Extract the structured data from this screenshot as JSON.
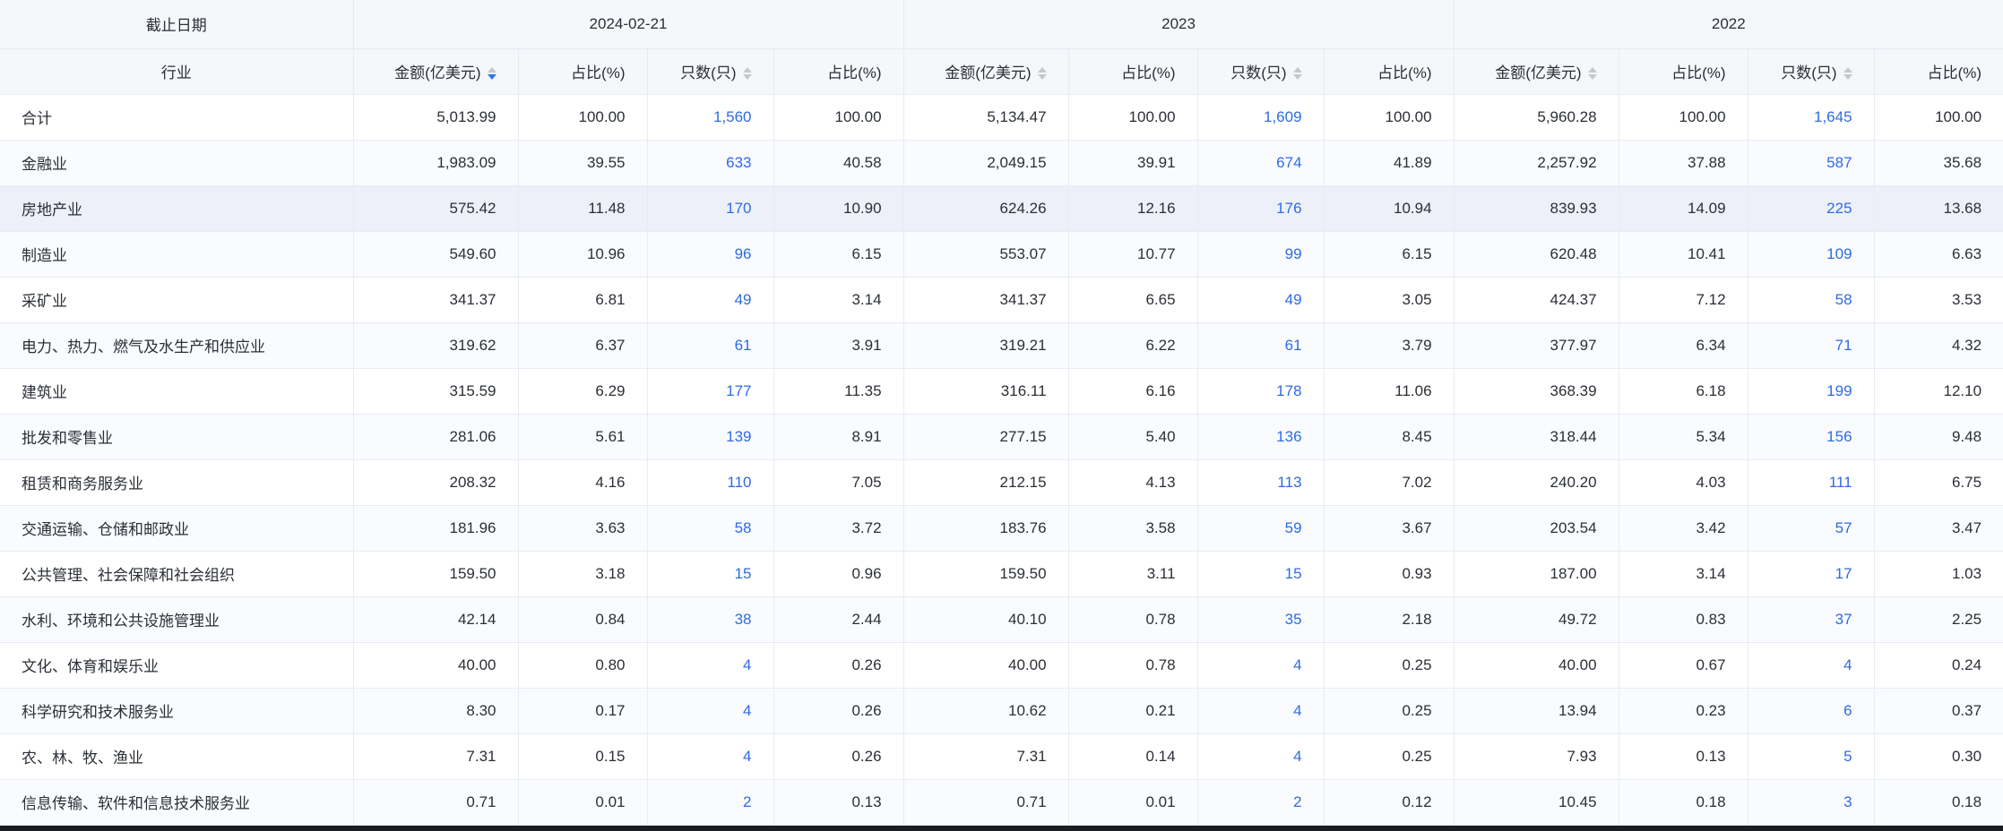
{
  "table": {
    "corner_label": "截止日期",
    "industry_label": "行业",
    "groups": [
      {
        "date": "2024-02-21"
      },
      {
        "date": "2023"
      },
      {
        "date": "2022"
      }
    ],
    "columns": {
      "amount": "金额(亿美元)",
      "share": "占比(%)",
      "count": "只数(只)",
      "share2": "占比(%)"
    },
    "sort_state": {
      "group": "2024-02-21",
      "column": "金额(亿美元)",
      "direction": "descending"
    },
    "rows": [
      {
        "industry": "合计",
        "highlighted": false,
        "cells": [
          [
            "5,013.99",
            "100.00",
            "1,560",
            "100.00"
          ],
          [
            "5,134.47",
            "100.00",
            "1,609",
            "100.00"
          ],
          [
            "5,960.28",
            "100.00",
            "1,645",
            "100.00"
          ]
        ]
      },
      {
        "industry": "金融业",
        "highlighted": false,
        "cells": [
          [
            "1,983.09",
            "39.55",
            "633",
            "40.58"
          ],
          [
            "2,049.15",
            "39.91",
            "674",
            "41.89"
          ],
          [
            "2,257.92",
            "37.88",
            "587",
            "35.68"
          ]
        ]
      },
      {
        "industry": "房地产业",
        "highlighted": true,
        "cells": [
          [
            "575.42",
            "11.48",
            "170",
            "10.90"
          ],
          [
            "624.26",
            "12.16",
            "176",
            "10.94"
          ],
          [
            "839.93",
            "14.09",
            "225",
            "13.68"
          ]
        ]
      },
      {
        "industry": "制造业",
        "highlighted": false,
        "cells": [
          [
            "549.60",
            "10.96",
            "96",
            "6.15"
          ],
          [
            "553.07",
            "10.77",
            "99",
            "6.15"
          ],
          [
            "620.48",
            "10.41",
            "109",
            "6.63"
          ]
        ]
      },
      {
        "industry": "采矿业",
        "highlighted": false,
        "cells": [
          [
            "341.37",
            "6.81",
            "49",
            "3.14"
          ],
          [
            "341.37",
            "6.65",
            "49",
            "3.05"
          ],
          [
            "424.37",
            "7.12",
            "58",
            "3.53"
          ]
        ]
      },
      {
        "industry": "电力、热力、燃气及水生产和供应业",
        "highlighted": false,
        "cells": [
          [
            "319.62",
            "6.37",
            "61",
            "3.91"
          ],
          [
            "319.21",
            "6.22",
            "61",
            "3.79"
          ],
          [
            "377.97",
            "6.34",
            "71",
            "4.32"
          ]
        ]
      },
      {
        "industry": "建筑业",
        "highlighted": false,
        "cells": [
          [
            "315.59",
            "6.29",
            "177",
            "11.35"
          ],
          [
            "316.11",
            "6.16",
            "178",
            "11.06"
          ],
          [
            "368.39",
            "6.18",
            "199",
            "12.10"
          ]
        ]
      },
      {
        "industry": "批发和零售业",
        "highlighted": false,
        "cells": [
          [
            "281.06",
            "5.61",
            "139",
            "8.91"
          ],
          [
            "277.15",
            "5.40",
            "136",
            "8.45"
          ],
          [
            "318.44",
            "5.34",
            "156",
            "9.48"
          ]
        ]
      },
      {
        "industry": "租赁和商务服务业",
        "highlighted": false,
        "cells": [
          [
            "208.32",
            "4.16",
            "110",
            "7.05"
          ],
          [
            "212.15",
            "4.13",
            "113",
            "7.02"
          ],
          [
            "240.20",
            "4.03",
            "111",
            "6.75"
          ]
        ]
      },
      {
        "industry": "交通运输、仓储和邮政业",
        "highlighted": false,
        "cells": [
          [
            "181.96",
            "3.63",
            "58",
            "3.72"
          ],
          [
            "183.76",
            "3.58",
            "59",
            "3.67"
          ],
          [
            "203.54",
            "3.42",
            "57",
            "3.47"
          ]
        ]
      },
      {
        "industry": "公共管理、社会保障和社会组织",
        "highlighted": false,
        "cells": [
          [
            "159.50",
            "3.18",
            "15",
            "0.96"
          ],
          [
            "159.50",
            "3.11",
            "15",
            "0.93"
          ],
          [
            "187.00",
            "3.14",
            "17",
            "1.03"
          ]
        ]
      },
      {
        "industry": "水利、环境和公共设施管理业",
        "highlighted": false,
        "cells": [
          [
            "42.14",
            "0.84",
            "38",
            "2.44"
          ],
          [
            "40.10",
            "0.78",
            "35",
            "2.18"
          ],
          [
            "49.72",
            "0.83",
            "37",
            "2.25"
          ]
        ]
      },
      {
        "industry": "文化、体育和娱乐业",
        "highlighted": false,
        "cells": [
          [
            "40.00",
            "0.80",
            "4",
            "0.26"
          ],
          [
            "40.00",
            "0.78",
            "4",
            "0.25"
          ],
          [
            "40.00",
            "0.67",
            "4",
            "0.24"
          ]
        ]
      },
      {
        "industry": "科学研究和技术服务业",
        "highlighted": false,
        "cells": [
          [
            "8.30",
            "0.17",
            "4",
            "0.26"
          ],
          [
            "10.62",
            "0.21",
            "4",
            "0.25"
          ],
          [
            "13.94",
            "0.23",
            "6",
            "0.37"
          ]
        ]
      },
      {
        "industry": "农、林、牧、渔业",
        "highlighted": false,
        "cells": [
          [
            "7.31",
            "0.15",
            "4",
            "0.26"
          ],
          [
            "7.31",
            "0.14",
            "4",
            "0.25"
          ],
          [
            "7.93",
            "0.13",
            "5",
            "0.30"
          ]
        ]
      },
      {
        "industry": "信息传输、软件和信息技术服务业",
        "highlighted": false,
        "cells": [
          [
            "0.71",
            "0.01",
            "2",
            "0.13"
          ],
          [
            "0.71",
            "0.01",
            "2",
            "0.12"
          ],
          [
            "10.45",
            "0.18",
            "3",
            "0.18"
          ]
        ]
      }
    ]
  },
  "icons": {
    "sort_asc": "caret-up",
    "sort_desc": "caret-down"
  },
  "colors": {
    "accent_blue": "#2f76e8",
    "link_blue": "#2e6be2",
    "header_background": "#f6f7fb",
    "stripe_background": "#fafbfe",
    "highlight_background": "#edf0f9",
    "border": "#e8ebf2",
    "text": "#2b2f36",
    "inactive_caret": "#c5c8ce"
  }
}
